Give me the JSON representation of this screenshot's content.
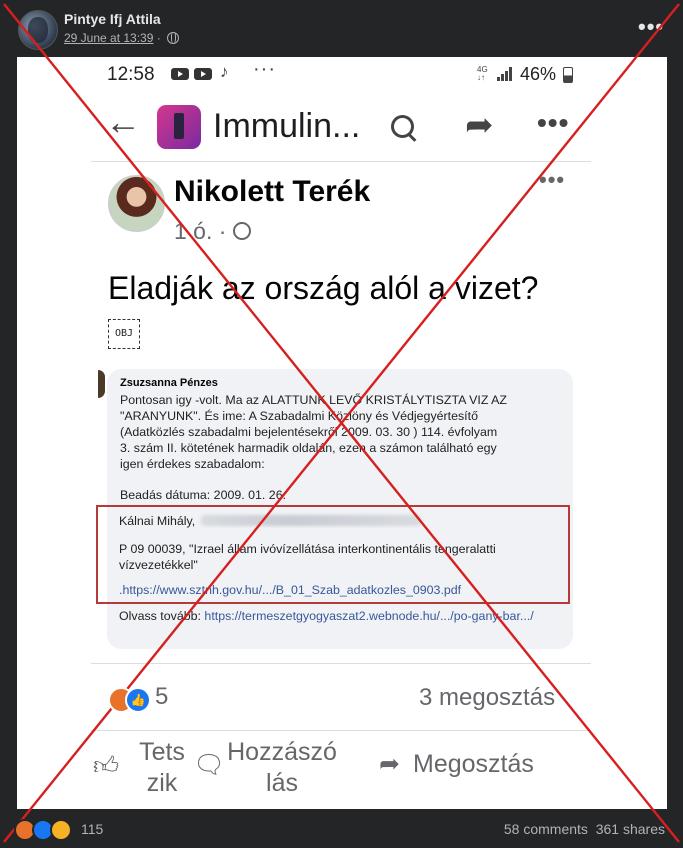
{
  "post": {
    "author": "Pintye Ifj Attila",
    "date": "29 June at 13:39",
    "separator": "·",
    "more_label": "•••"
  },
  "screenshot": {
    "status_bar": {
      "time": "12:58",
      "dots": "···",
      "network": "4G",
      "battery": "46%"
    },
    "app_bar": {
      "page_title": "Immulin..."
    },
    "inner_post": {
      "author": "Nikolett Terék",
      "meta": "1 ó. ·",
      "more_label": "•••",
      "text": "Eladják az ország alól a vizet?",
      "obj_label": "OBJ"
    },
    "embedded_comment": {
      "author": "Zsuzsanna Pénzes",
      "lines": [
        "Pontosan igy -volt. Ma az ALATTUNK LEVŐ KRISTÁLYTISZTA VIZ AZ",
        "\"ARANYUNK\". És ime: A Szabadalmi Közlöny és Védjegyértesítő",
        "(Adatközlés szabadalmi bejelentésekről 2009. 03. 30 ) 114. évfolyam",
        "3. szám II. kötetének harmadik oldalán, ezen a számon található egy",
        "igen érdekes szabadalom:"
      ],
      "date_line": "Beadás dátuma: 2009. 01. 26.",
      "boxed_name": "Kálnai Mihály,",
      "boxed_patent": "P 09 00039, \"Izrael állam ivóvízellátása interkontinentális tengeralatti vízvezetékkel\"",
      "boxed_link": ".https://www.sztnh.gov.hu/.../B_01_Szab_adatkozles_0903.pdf",
      "read_more_label": "Olvass tovább:",
      "read_more_link": "https://termeszetgyogyaszat2.webnode.hu/.../po-gany-bar.../"
    },
    "stats": {
      "reaction_count": "5",
      "shares": "3 megosztás"
    },
    "actions": {
      "like": "Tetszik",
      "comment": "Hozzászólás",
      "share": "Megosztás"
    }
  },
  "footer": {
    "reaction_count": "115",
    "comments": "58 comments",
    "shares": "361 shares"
  },
  "colors": {
    "dark_bg": "#242526",
    "overlay_x": "#d62020",
    "like_blue": "#1877f2",
    "angry_orange": "#e8722a",
    "wow_yellow": "#f7b125",
    "highlight_box": "#b53b3b"
  }
}
